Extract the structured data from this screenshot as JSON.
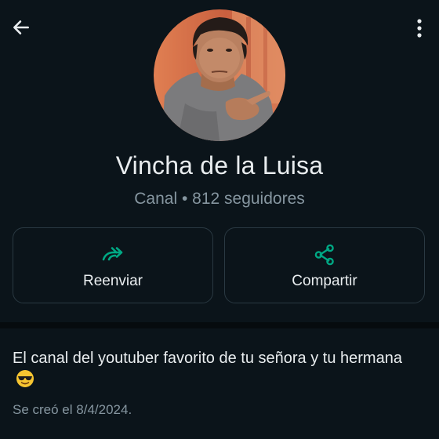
{
  "topbar": {
    "back_icon": "arrow-left-icon",
    "menu_icon": "more-vertical-icon"
  },
  "channel": {
    "name": "Vincha de la Luisa",
    "meta": "Canal • 812 seguidores",
    "avatar": "profile-photo"
  },
  "actions": {
    "forward_label": "Reenviar",
    "forward_icon": "forward-icon",
    "share_label": "Compartir",
    "share_icon": "share-icon",
    "accent_color": "#00a884"
  },
  "about": {
    "description": "El canal del youtuber favorito de tu señora y tu hermana",
    "emoji": "smiling-face-with-sunglasses",
    "created": "Se creó el 8/4/2024."
  },
  "colors": {
    "background": "#0b141a",
    "text_primary": "#e9edef",
    "text_secondary": "#8696a0",
    "border": "#2a3942"
  }
}
